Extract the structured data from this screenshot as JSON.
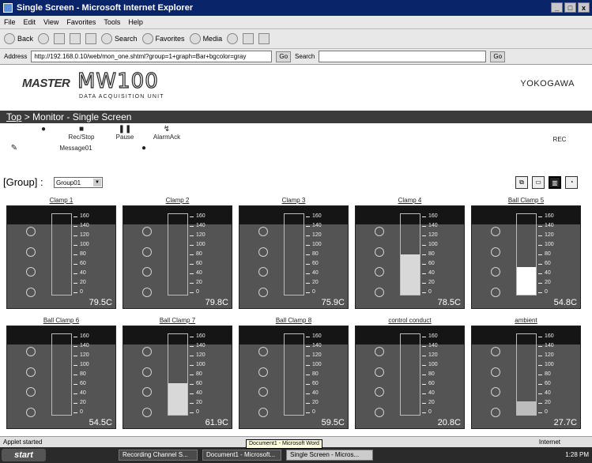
{
  "window": {
    "title": "Single Screen - Microsoft Internet Explorer",
    "btn_min": "_",
    "btn_max": "□",
    "btn_close": "x"
  },
  "menu": [
    "File",
    "Edit",
    "View",
    "Favorites",
    "Tools",
    "Help"
  ],
  "toolbar": {
    "back": "Back",
    "search": "Search",
    "favorites": "Favorites",
    "media": "Media"
  },
  "address": {
    "label": "Address",
    "url": "http://192.168.0.10/web/mon_one.shtml?group=1+graph=Bar+bgcolor=gray",
    "go": "Go",
    "search_label": "Search"
  },
  "brand": {
    "master": "MASTER",
    "model": "MW100",
    "subtitle": "DATA ACQUISITION UNIT",
    "company": "YOKOGAWA"
  },
  "breadcrumb": {
    "top": "Top",
    "rest": " > Monitor - Single Screen"
  },
  "controls": {
    "rec_stop": "Rec/Stop",
    "pause": "Pause",
    "alarm_ack": "AlarmAck",
    "message": "Message01",
    "status": "REC"
  },
  "group": {
    "label": "[Group] :",
    "selected": "Group01"
  },
  "panels": [
    {
      "name": "Clamp 1",
      "value": "79.5C",
      "level": 0,
      "scale": [
        "160",
        "140",
        "120",
        "100",
        "80",
        "60",
        "40",
        "20",
        "0"
      ]
    },
    {
      "name": "Clamp 2",
      "value": "79.8C",
      "level": 0,
      "scale": [
        "160",
        "140",
        "120",
        "100",
        "80",
        "60",
        "40",
        "20",
        "0"
      ]
    },
    {
      "name": "Clamp 3",
      "value": "75.9C",
      "level": 0,
      "scale": [
        "160",
        "140",
        "120",
        "100",
        "80",
        "60",
        "40",
        "20",
        "0"
      ]
    },
    {
      "name": "Clamp 4",
      "value": "78.5C",
      "level": 0.5,
      "fill": "#d8d8d8",
      "scale": [
        "160",
        "140",
        "120",
        "100",
        "80",
        "60",
        "40",
        "20",
        "0"
      ]
    },
    {
      "name": "Ball Clamp 5",
      "value": "54.8C",
      "level": 0.34,
      "fill": "#ffffff",
      "scale": [
        "160",
        "140",
        "120",
        "100",
        "80",
        "60",
        "40",
        "20",
        "0"
      ]
    },
    {
      "name": "Ball Clamp 6",
      "value": "54.5C",
      "level": 0,
      "scale": [
        "160",
        "140",
        "120",
        "100",
        "80",
        "60",
        "40",
        "20",
        "0"
      ]
    },
    {
      "name": "Ball Clamp 7",
      "value": "61.9C",
      "level": 0.39,
      "fill": "#d8d8d8",
      "scale": [
        "160",
        "140",
        "120",
        "100",
        "80",
        "60",
        "40",
        "20",
        "0"
      ]
    },
    {
      "name": "Ball Clamp 8",
      "value": "59.5C",
      "level": 0,
      "scale": [
        "160",
        "140",
        "120",
        "100",
        "80",
        "60",
        "40",
        "20",
        "0"
      ]
    },
    {
      "name": "control conduct",
      "value": "20.8C",
      "level": 0,
      "scale": [
        "160",
        "140",
        "120",
        "100",
        "80",
        "60",
        "40",
        "20",
        "0"
      ]
    },
    {
      "name": "ambient",
      "value": "27.7C",
      "level": 0.17,
      "fill": "#bdbdbd",
      "scale": [
        "160",
        "140",
        "120",
        "100",
        "80",
        "60",
        "40",
        "20",
        "0"
      ]
    }
  ],
  "statusbar": {
    "left": "Applet started",
    "zone": "Internet"
  },
  "taskbar": {
    "start": "start",
    "tasks": [
      "Recording Channel S...",
      "Document1 - Microsoft...",
      "Single Screen - Micros..."
    ],
    "tooltip": "Document1 - Microsoft Word",
    "clock": "1:28 PM"
  }
}
